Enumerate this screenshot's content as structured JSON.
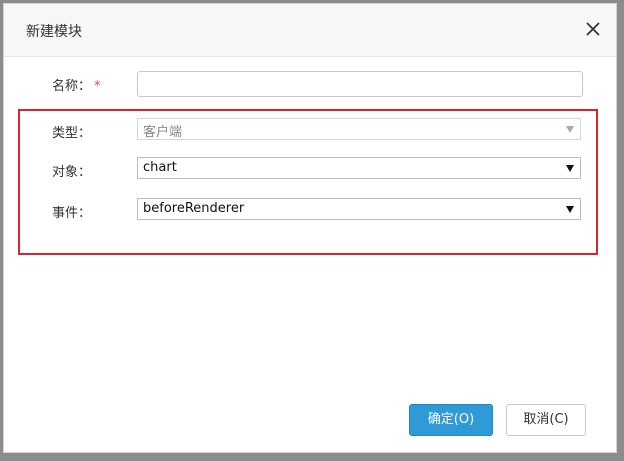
{
  "dialog": {
    "title": "新建模块",
    "close_icon": "close-icon"
  },
  "form": {
    "name": {
      "label": "名称：",
      "required_mark": "*",
      "value": ""
    },
    "type": {
      "label": "类型：",
      "value": "客户端",
      "disabled": true
    },
    "object": {
      "label": "对象：",
      "value": "chart"
    },
    "event": {
      "label": "事件：",
      "value": "beforeRenderer"
    }
  },
  "buttons": {
    "ok_label": "确定(O)",
    "cancel_label": "取消(C)"
  },
  "colors": {
    "primary": "#2e9bd6",
    "highlight": "#d9262a",
    "required": "#e74c3c"
  }
}
